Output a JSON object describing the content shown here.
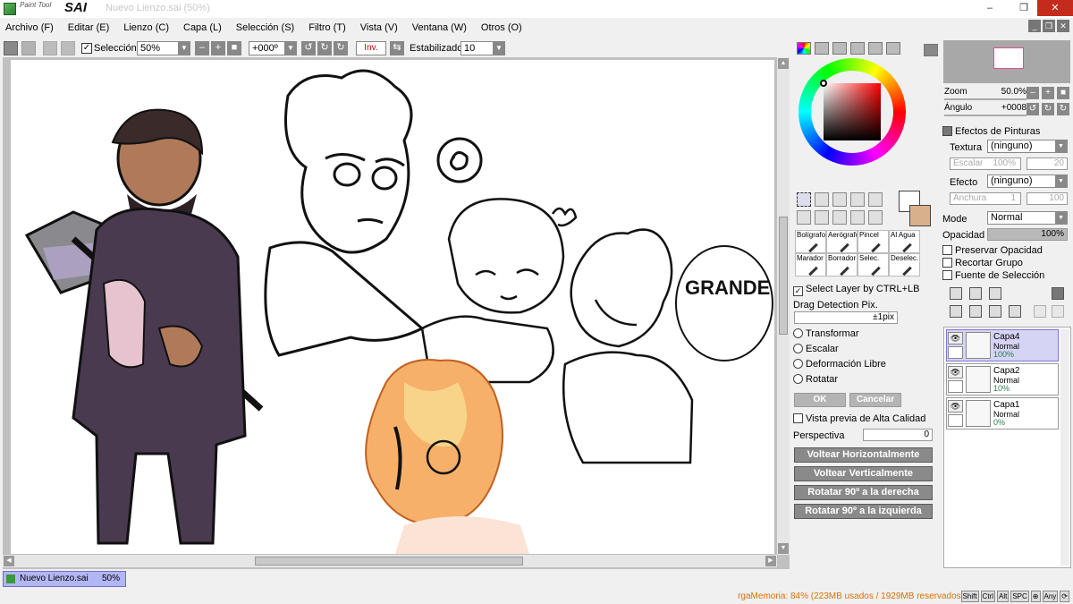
{
  "app": {
    "logo_small": "Paint Tool",
    "logo_sai": "SAI",
    "title": "Nuevo Lienzo.sai (50%)"
  },
  "window_controls": {
    "minimize": "–",
    "maximize": "❐",
    "close": "✕"
  },
  "menu": [
    "Archivo (F)",
    "Editar (E)",
    "Lienzo (C)",
    "Capa (L)",
    "Selección (S)",
    "Filtro (T)",
    "Vista (V)",
    "Ventana (W)",
    "Otros (O)"
  ],
  "toolbar": {
    "selection_label": "Selección",
    "selection_checked": true,
    "zoom": "50%",
    "minus": "–",
    "plus": "+",
    "reset": "■",
    "angle": "+000º",
    "inv": "Inv.",
    "stabilizer_label": "Estabilizador",
    "stabilizer_value": "10"
  },
  "canvas_text": {
    "speech": "GRANDE UWU!"
  },
  "color_swatches": {
    "main": "#ffffff",
    "secondary": "#d9b08c"
  },
  "brushes": [
    {
      "label": "Bolígrafo"
    },
    {
      "label": "Aerógrafo"
    },
    {
      "label": "Pincel"
    },
    {
      "label": "Al Agua"
    },
    {
      "label": "Marador"
    },
    {
      "label": "Borrador"
    },
    {
      "label": "Selec."
    },
    {
      "label": "Deselec."
    }
  ],
  "tool_options": {
    "select_layer": "Select Layer by CTRL+LB",
    "drag_detection": "Drag Detection Pix.",
    "drag_value": "±1pix",
    "transform_modes": [
      "Transformar",
      "Escalar",
      "Deformación Libre",
      "Rotatar"
    ],
    "ok": "OK",
    "cancel": "Cancelar",
    "hq_preview": "Vista previa de Alta Calidad",
    "perspective_label": "Perspectiva",
    "perspective_value": "0",
    "actions": [
      "Voltear Horizontalmente",
      "Voltear Verticalmente",
      "Rotatar 90º a la derecha",
      "Rotatar 90º a la izquierda"
    ]
  },
  "navigator": {
    "zoom_label": "Zoom",
    "zoom_value": "50.0%",
    "angle_label": "Ángulo",
    "angle_value": "+0008"
  },
  "effects": {
    "header": "Efectos de Pinturas",
    "texture_label": "Textura",
    "texture_value": "(ninguno)",
    "scale_label": "Escalar",
    "scale_value": "100%",
    "scale_num": "20",
    "effect_label": "Efecto",
    "effect_value": "(ninguno)",
    "width_label": "Anchura",
    "width_value": "1",
    "width_num": "100"
  },
  "layer_props": {
    "mode_label": "Mode",
    "mode_value": "Normal",
    "opacity_label": "Opacidad",
    "opacity_value": "100%",
    "opacity_fraction": 1.0,
    "preserve_opacity": "Preservar Opacidad",
    "clip_group": "Recortar Grupo",
    "selection_source": "Fuente de Selección"
  },
  "layers": [
    {
      "name": "Capa4",
      "mode": "Normal",
      "opacity": "100%",
      "selected": true
    },
    {
      "name": "Capa2",
      "mode": "Normal",
      "opacity": "10%",
      "selected": false
    },
    {
      "name": "Capa1",
      "mode": "Normal",
      "opacity": "0%",
      "selected": false
    }
  ],
  "status": {
    "doc_name": "Nuevo Lienzo.sai",
    "doc_zoom": "50%",
    "memory": "rgaMemoria: 84% (223MB usados / 1929MB reservados)",
    "keys": [
      "Shift",
      "Ctrl",
      "Alt",
      "SPC",
      "⊕",
      "Any",
      "⟳"
    ]
  }
}
